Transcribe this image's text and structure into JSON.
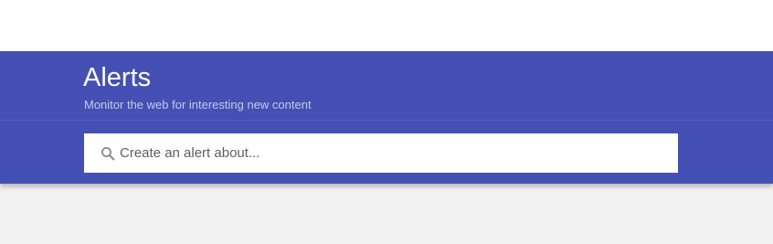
{
  "header": {
    "title": "Alerts",
    "subtitle": "Monitor the web for interesting new content"
  },
  "search": {
    "icon": "search-icon",
    "placeholder": "Create an alert about...",
    "value": ""
  },
  "colors": {
    "header_background": "#4450b3",
    "page_background": "#f1f1f1",
    "top_bar_background": "#ffffff"
  }
}
